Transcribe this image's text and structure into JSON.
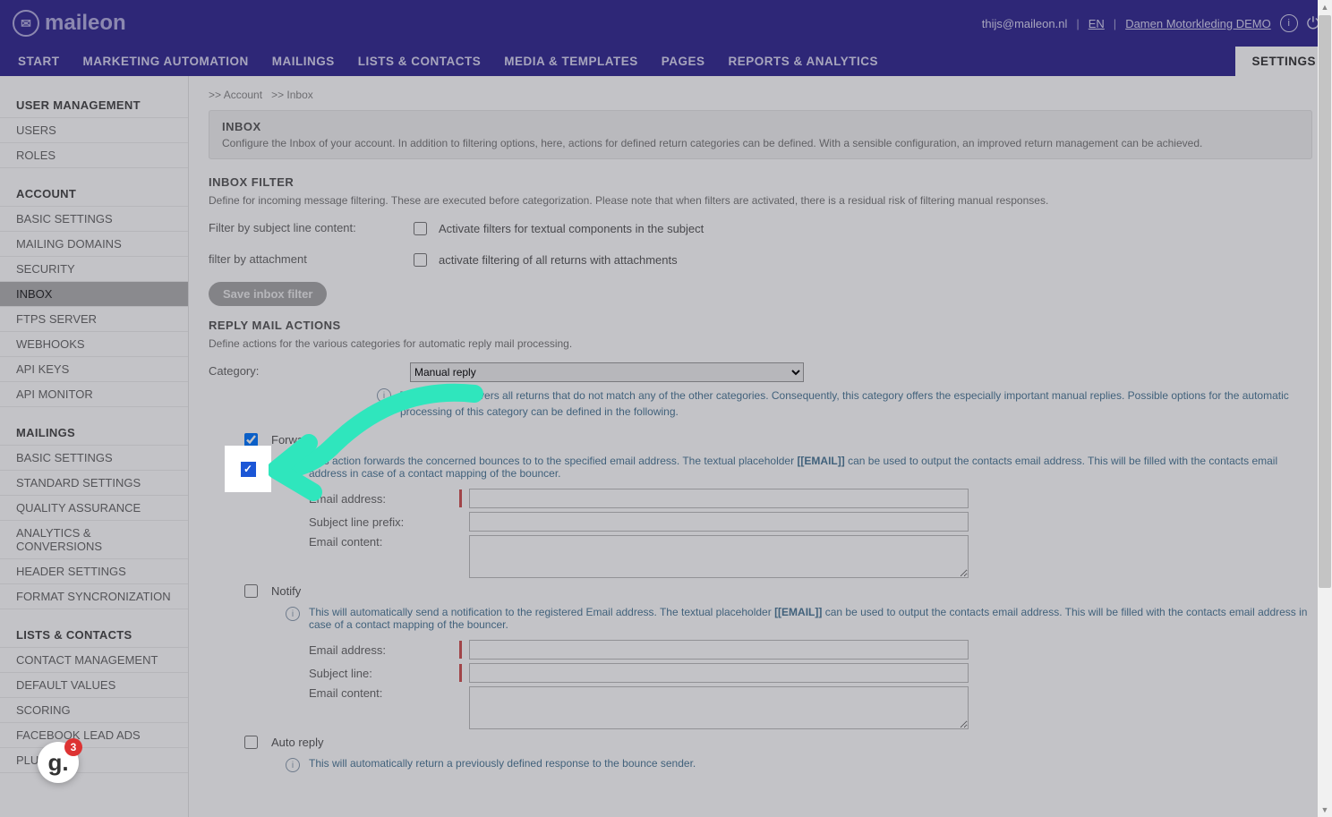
{
  "brand": "maileon",
  "topbar": {
    "email": "thijs@maileon.nl",
    "lang": "EN",
    "account": "Damen Motorkleding DEMO"
  },
  "nav": {
    "start": "START",
    "ma": "MARKETING AUTOMATION",
    "mailings": "MAILINGS",
    "lists": "LISTS & CONTACTS",
    "media": "MEDIA & TEMPLATES",
    "pages": "PAGES",
    "reports": "REPORTS & ANALYTICS",
    "settings": "SETTINGS"
  },
  "sidebar": {
    "g1": {
      "title": "USER MANAGEMENT",
      "items": [
        "USERS",
        "ROLES"
      ]
    },
    "g2": {
      "title": "ACCOUNT",
      "items": [
        "BASIC SETTINGS",
        "MAILING DOMAINS",
        "SECURITY",
        "INBOX",
        "FTPS SERVER",
        "WEBHOOKS",
        "API KEYS",
        "API MONITOR"
      ]
    },
    "g3": {
      "title": "MAILINGS",
      "items": [
        "BASIC SETTINGS",
        "STANDARD SETTINGS",
        "QUALITY ASSURANCE",
        "ANALYTICS & CONVERSIONS",
        "HEADER SETTINGS",
        "FORMAT SYNCRONIZATION"
      ]
    },
    "g4": {
      "title": "LISTS & CONTACTS",
      "items": [
        "CONTACT MANAGEMENT",
        "DEFAULT VALUES",
        "SCORING",
        "FACEBOOK LEAD ADS",
        "PLUGINS"
      ]
    }
  },
  "breadcrumb": {
    "a": ">> Account",
    "b": ">> Inbox"
  },
  "inbox_panel": {
    "title": "INBOX",
    "desc": "Configure the Inbox of your account. In addition to filtering options, here, actions for defined return categories can be defined. With a sensible configuration, an improved return management can be achieved."
  },
  "filter": {
    "title": "INBOX FILTER",
    "desc": "Define for incoming message filtering. These are executed before categorization. Please note that when filters are activated, there is a residual risk of filtering manual responses.",
    "row1_label": "Filter by subject line content:",
    "row1_chk": "Activate filters for textual components in the subject",
    "row2_label": "filter by attachment",
    "row2_chk": "activate filtering of all returns with attachments",
    "save_btn": "Save inbox filter"
  },
  "reply": {
    "title": "REPLY MAIL ACTIONS",
    "desc": "Define actions for the various categories for automatic reply mail processing.",
    "cat_label": "Category:",
    "cat_value": "Manual reply",
    "cat_info": "This category covers all returns that do not match any of the other categories. Consequently, this category offers the especially important manual replies. Possible options for the automatic processing of this category can be defined in the following.",
    "forward": {
      "label": "Forward",
      "info_a": "This action forwards the concerned bounces to to the specified email address. The textual placeholder ",
      "info_tag": "[[EMAIL]]",
      "info_b": " can be used to output the contacts email address. This will be filled with the contacts email address in case of a contact mapping of the bouncer.",
      "email": "Email address:",
      "subj": "Subject line prefix:",
      "content": "Email content:"
    },
    "notify": {
      "label": "Notify",
      "info_a": "This will automatically send a notification to the registered Email address. The textual placeholder ",
      "info_tag": "[[EMAIL]]",
      "info_b": " can be used to output the contacts email address. This will be filled with the contacts email address in case of a contact mapping of the bouncer.",
      "email": "Email address:",
      "subj": "Subject line:",
      "content": "Email content:"
    },
    "autoreply": {
      "label": "Auto reply",
      "info": "This will automatically return a previously defined response to the bounce sender."
    }
  },
  "fab": {
    "badge": "3",
    "glyph": "g."
  }
}
